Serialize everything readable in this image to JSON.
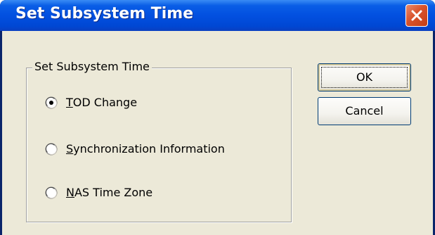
{
  "window": {
    "title": "Set Subsystem Time",
    "close_icon": "close-icon"
  },
  "group": {
    "legend": "Set Subsystem Time",
    "options": [
      {
        "mnemonic": "T",
        "rest": "OD Change",
        "checked": true
      },
      {
        "mnemonic": "S",
        "rest": "ynchronization Information",
        "checked": false
      },
      {
        "mnemonic": "N",
        "rest": "AS Time Zone",
        "checked": false
      }
    ]
  },
  "buttons": {
    "ok_label": "OK",
    "cancel_label": "Cancel"
  },
  "colors": {
    "titlebar": "#0250e0",
    "client": "#ece9d8",
    "close_button": "#d9532c",
    "button_border": "#003c74"
  }
}
